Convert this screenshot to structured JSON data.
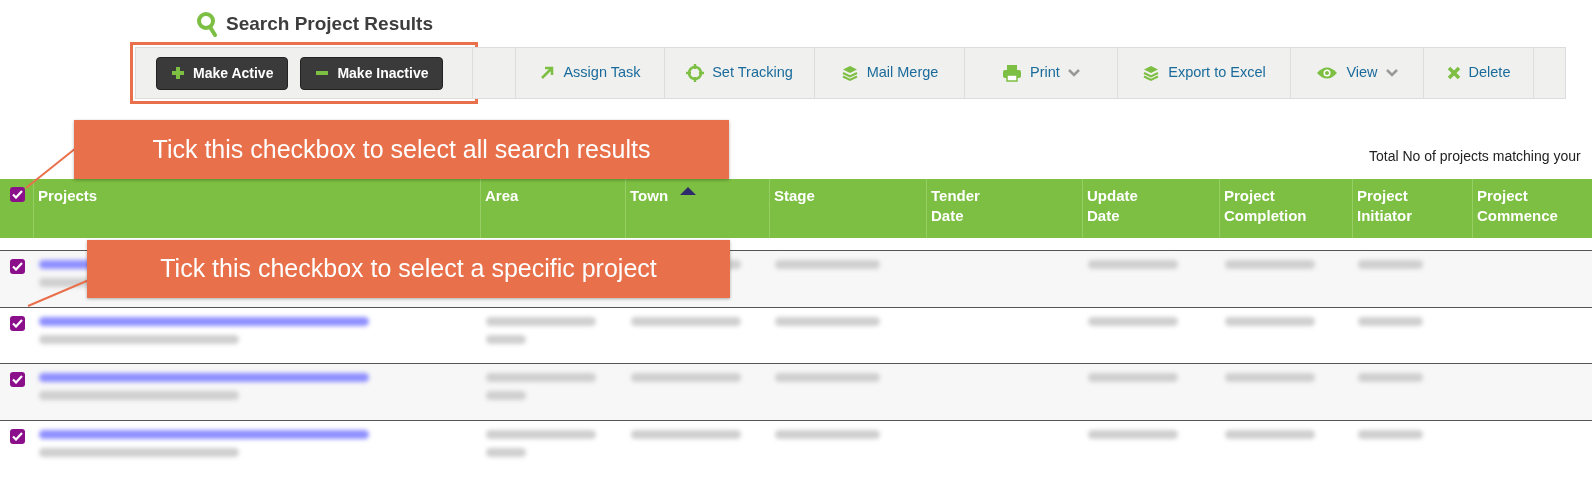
{
  "title": "Search Project Results",
  "toolbar": {
    "primary": [
      {
        "label": "Make Active"
      },
      {
        "label": "Make Inactive"
      }
    ],
    "actions": [
      {
        "label": "Assign Task",
        "dropdown": false
      },
      {
        "label": "Set Tracking",
        "dropdown": false
      },
      {
        "label": "Mail Merge",
        "dropdown": false
      },
      {
        "label": "Print",
        "dropdown": true
      },
      {
        "label": "Export to Excel",
        "dropdown": false
      },
      {
        "label": "View",
        "dropdown": true
      },
      {
        "label": "Delete",
        "dropdown": false
      }
    ]
  },
  "total_text": "Total No of projects matching your",
  "callouts": [
    "Tick this checkbox to select all search results",
    "Tick this checkbox to select a specific project"
  ],
  "table": {
    "select_all": {
      "checked": true
    },
    "columns": [
      {
        "label": "Projects",
        "sorted": false
      },
      {
        "label": "Area",
        "sorted": false
      },
      {
        "label": "Town",
        "sorted": true
      },
      {
        "label": "Stage",
        "sorted": false
      },
      {
        "label": "Tender Date",
        "sorted": false
      },
      {
        "label": "Update Date",
        "sorted": false
      },
      {
        "label": "Project Completion",
        "sorted": false
      },
      {
        "label": "Project Initiator",
        "sorted": false
      },
      {
        "label": "Project Commence",
        "sorted": false
      }
    ],
    "rows": [
      {
        "checked": true
      },
      {
        "checked": true
      },
      {
        "checked": true
      },
      {
        "checked": true
      }
    ]
  }
}
